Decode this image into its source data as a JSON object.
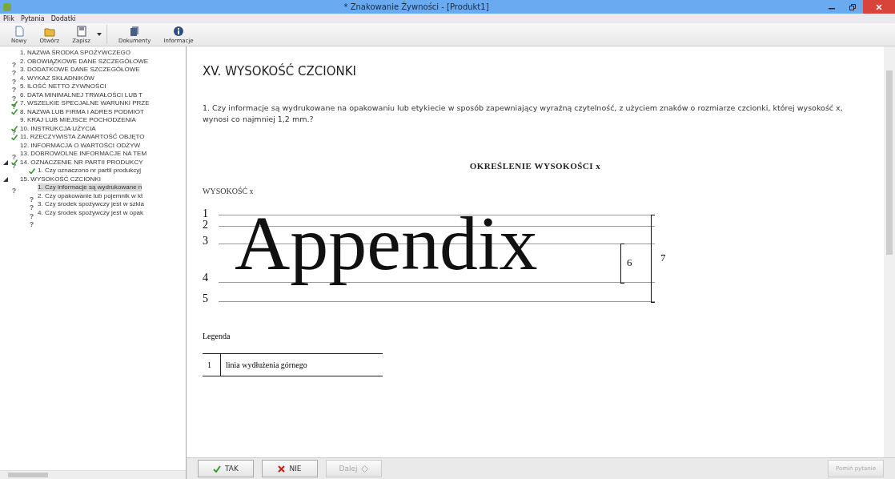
{
  "window": {
    "title": "* Znakowanie Żywności - [Produkt1]"
  },
  "menu": [
    "Plik",
    "Pytania",
    "Dodatki"
  ],
  "toolbar": [
    {
      "label": "Nowy",
      "kind": "new"
    },
    {
      "label": "Otwórz",
      "kind": "open"
    },
    {
      "label": "Zapisz",
      "kind": "save"
    },
    {
      "label": "Dokumenty",
      "kind": "docs"
    },
    {
      "label": "Informacje",
      "kind": "info"
    }
  ],
  "tree": [
    {
      "label": "1. NAZWA ŚRODKA SPOŻYWCZEGO",
      "answered": false,
      "mark": "?",
      "selected": false
    },
    {
      "label": "2. OBOWIĄZKOWE DANE SZCZEGÓŁOWE",
      "answered": false,
      "mark": "?",
      "selected": false
    },
    {
      "label": "3. DODATKOWE DANE SZCZEGÓŁOWE",
      "answered": false,
      "mark": "?",
      "selected": false
    },
    {
      "label": "4. WYKAZ SKŁADNIKÓW",
      "answered": false,
      "mark": "?",
      "selected": false
    },
    {
      "label": "5. ILOŚĆ NETTO ŻYWNOŚCI",
      "answered": false,
      "mark": "?",
      "selected": false
    },
    {
      "label": "6. DATA MINIMALNEJ TRWAŁOŚCI LUB T",
      "answered": false,
      "mark": "?",
      "selected": false
    },
    {
      "label": "7. WSZELKIE SPECJALNE WARUNKI PRZE",
      "answered": true,
      "selected": false
    },
    {
      "label": "8. NAZWA LUB FIRMA I ADRES PODMIOT",
      "answered": true,
      "selected": false
    },
    {
      "label": "9. KRAJ LUB MIEJSCE POCHODZENIA",
      "answered": false,
      "mark": "?",
      "selected": false
    },
    {
      "label": "10. INSTRUKCJA UŻYCIA",
      "answered": true,
      "selected": false
    },
    {
      "label": "11. RZECZYWISTA ZAWARTOŚĆ OBJĘTO",
      "answered": true,
      "selected": false
    },
    {
      "label": "12. INFORMACJA O WARTOŚCI ODŻYW",
      "answered": false,
      "mark": "?",
      "selected": false
    },
    {
      "label": "13. DOBROWOLNE INFORMACJE NA TEM",
      "answered": false,
      "mark": "?",
      "selected": false
    },
    {
      "label": "14. OZNACZENIE NR PARTII PRODUKCY",
      "answered": true,
      "selected": false,
      "expanded": true,
      "children": [
        {
          "label": "1. Czy oznaczono nr partii produkcyj",
          "answered": true,
          "selected": false
        }
      ]
    },
    {
      "label": "15. WYSOKOŚĆ CZCIONKI",
      "answered": false,
      "mark": "?",
      "selected": false,
      "expanded": true,
      "children": [
        {
          "label": "1. Czy informacje są wydrukowane n",
          "answered": false,
          "mark": "?",
          "selected": true
        },
        {
          "label": "2. Czy opakowanie lub pojemnik w kt",
          "answered": false,
          "mark": "?",
          "selected": false
        },
        {
          "label": "3. Czy środek spożywczy jest w szkla",
          "answered": false,
          "mark": "?",
          "selected": false
        },
        {
          "label": "4. Czy środek spożywczy jest w  opak",
          "answered": false,
          "mark": "?",
          "selected": false
        }
      ]
    }
  ],
  "content": {
    "heading": "XV. WYSOKOŚĆ CZCIONKI",
    "question": "1.  Czy informacje są wydrukowane na opakowaniu lub etykiecie w sposób zapewniający wyraźną czytelność, z użyciem znaków o rozmiarze czcionki, której wysokość x, wynosi co najmniej 1,2 mm.?",
    "figure_title": "OKREŚLENIE WYSOKOŚCI x",
    "figure_label": "WYSOKOŚĆ x",
    "sample_word": "Appendix",
    "line_numbers": [
      "1",
      "2",
      "3",
      "4",
      "5"
    ],
    "measure_labels": [
      "6",
      "7"
    ],
    "legend_title": "Legenda",
    "legend_rows": [
      {
        "number": "1",
        "text": "linia wydłużenia górnego"
      }
    ]
  },
  "buttons": [
    {
      "label": "TAK",
      "kind": "yes",
      "disabled": false
    },
    {
      "label": "NIE",
      "kind": "no",
      "disabled": false
    },
    {
      "label": "Dalej",
      "kind": "next",
      "disabled": true
    },
    {
      "label": "Pomiń pytanie",
      "kind": "skip",
      "disabled": true
    }
  ]
}
